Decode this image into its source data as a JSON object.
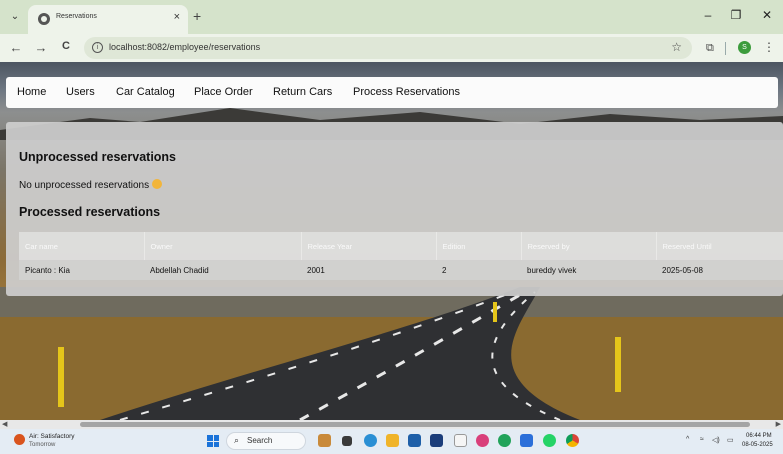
{
  "browser": {
    "tab_title": "Reservations",
    "tab_close": "×",
    "new_tab": "+",
    "url": "localhost:8082/employee/reservations",
    "profile_initial": "S",
    "window_buttons": {
      "minimize": "–",
      "restore": "❐",
      "close": "✕"
    },
    "nav": {
      "back": "←",
      "forward": "→",
      "reload": "C"
    }
  },
  "navbar": {
    "links": [
      "Home",
      "Users",
      "Car Catalog",
      "Place Order",
      "Return Cars",
      "Process Reservations"
    ]
  },
  "page": {
    "unprocessed_title": "Unprocessed reservations",
    "unprocessed_empty": "No unprocessed reservations",
    "processed_title": "Processed reservations"
  },
  "table": {
    "headers": [
      "Car name",
      "Owner",
      "Release Year",
      "Edition",
      "Reserved by",
      "Reserved Until"
    ],
    "rows": [
      [
        "Picanto : Kia",
        "Abdellah Chadid",
        "2001",
        "2",
        "bureddy vivek",
        "2025-05-08"
      ]
    ]
  },
  "taskbar": {
    "weather_line1": "Air: Satisfactory",
    "weather_line2": "Tomorrow",
    "search_label": "Search",
    "time": "06:44 PM",
    "date": "08-05-2025"
  },
  "icons": {
    "search-icon": "magnifier",
    "star-icon": "bookmark star",
    "extensions-icon": "puzzle",
    "menu-icon": "three dots",
    "info-icon": "site info"
  }
}
